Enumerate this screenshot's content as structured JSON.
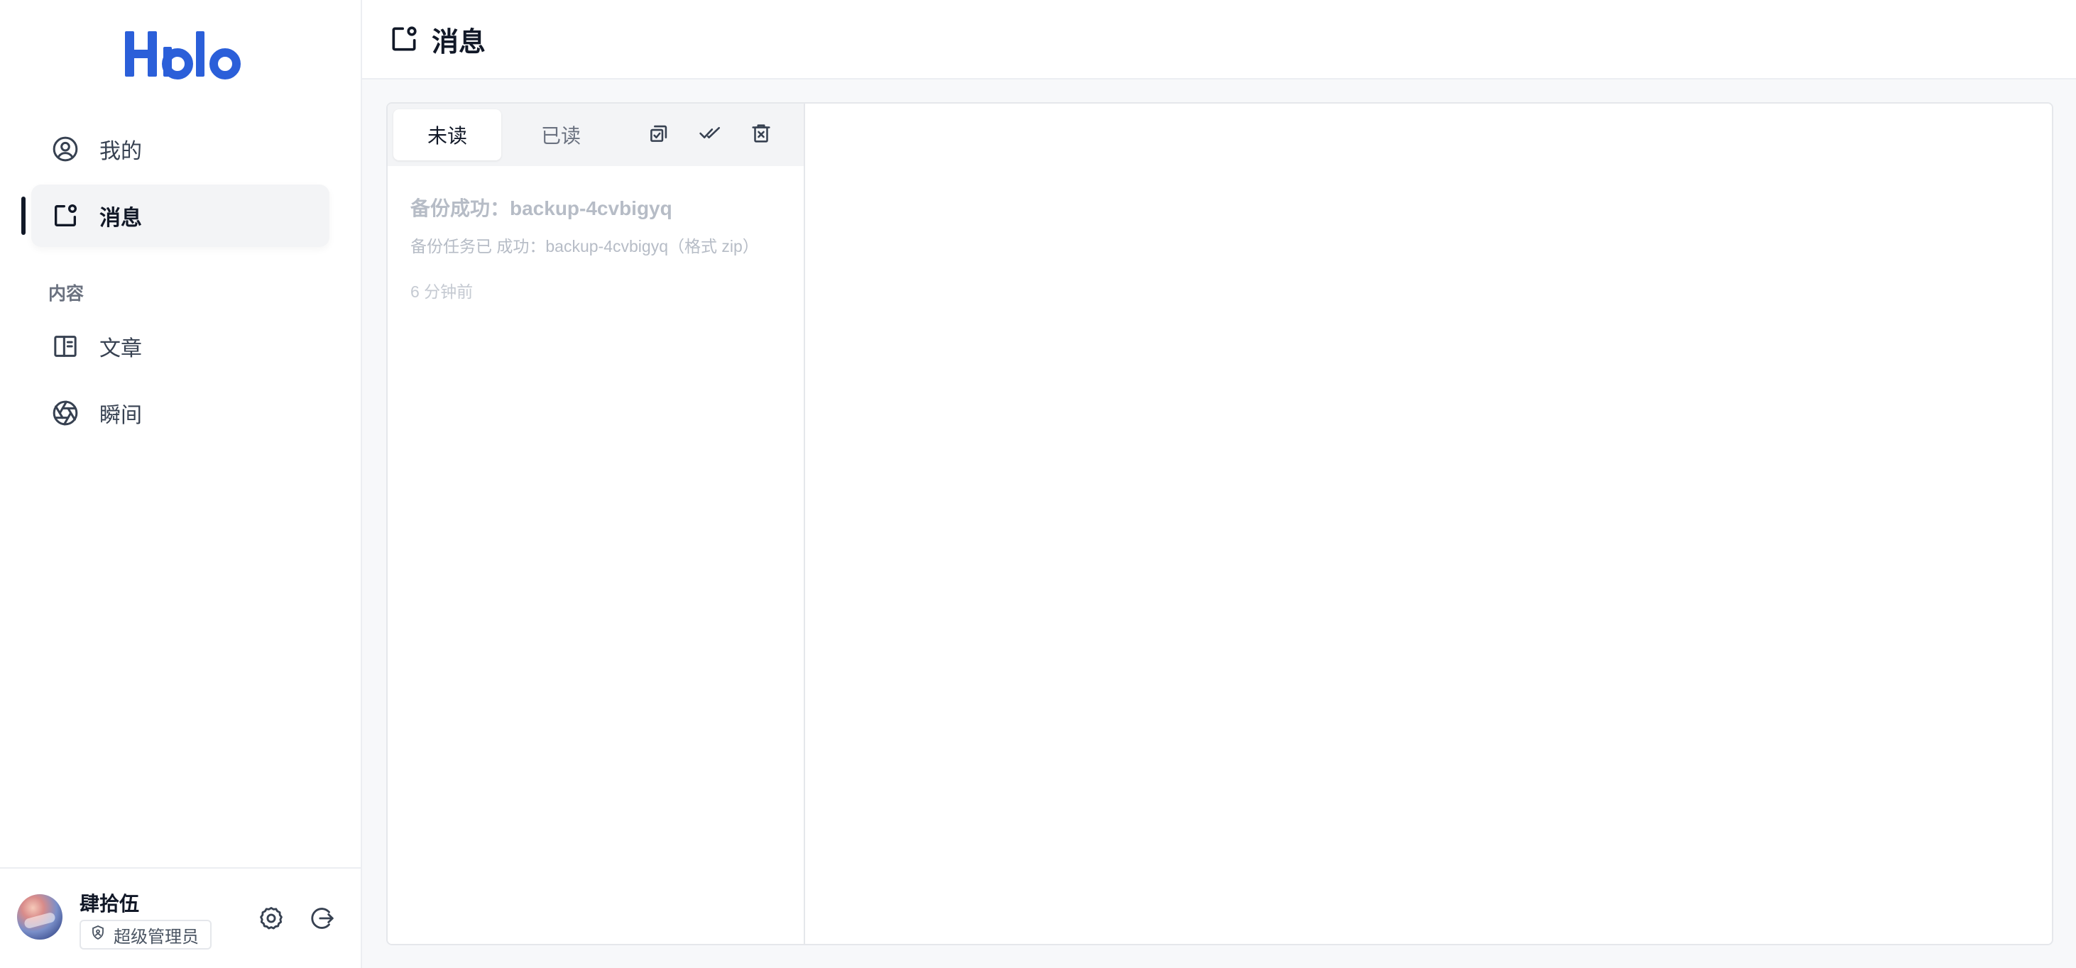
{
  "app": {
    "logo_text": "Halo",
    "brand_color": "#2b5fd9"
  },
  "sidebar": {
    "items": [
      {
        "label": "我的",
        "icon": "user-circle-icon",
        "active": false
      },
      {
        "label": "消息",
        "icon": "notification-icon",
        "active": true
      }
    ],
    "groups": [
      {
        "title": "内容",
        "items": [
          {
            "label": "文章",
            "icon": "book-icon"
          },
          {
            "label": "瞬间",
            "icon": "aperture-icon"
          }
        ]
      }
    ]
  },
  "user": {
    "name": "肆拾伍",
    "role": "超级管理员"
  },
  "header": {
    "title": "消息",
    "icon": "notification-icon"
  },
  "tabs": [
    {
      "label": "未读",
      "active": true
    },
    {
      "label": "已读",
      "active": false
    }
  ],
  "toolbar_actions": [
    "select-all-icon",
    "mark-all-read-icon",
    "delete-icon"
  ],
  "messages": [
    {
      "title": "备份成功：backup-4cvbigyq",
      "description": "备份任务已 成功：backup-4cvbigyq（格式 zip）",
      "time": "6 分钟前"
    }
  ]
}
